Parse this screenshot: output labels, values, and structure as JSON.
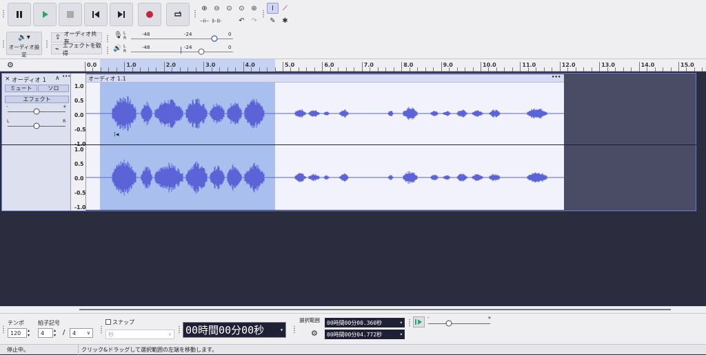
{
  "toolbar": {
    "audio_setup_label": "オーディオ設定",
    "share_audio_label": "オーディオ共有",
    "get_effects_label": "エフェクトを取得",
    "rec_meter": {
      "l": "L",
      "r": "R",
      "marks": [
        "-48",
        "-24",
        "0"
      ]
    },
    "play_meter": {
      "l": "L",
      "r": "R",
      "marks": [
        "-48",
        "-24",
        "0"
      ]
    }
  },
  "ruler": {
    "labels": [
      "0.0",
      "1.0",
      "2.0",
      "3.0",
      "4.0",
      "5.0",
      "6.0",
      "7.0",
      "8.0",
      "9.0",
      "10.0",
      "11.0",
      "12.0",
      "13.0",
      "14.0",
      "15.0"
    ]
  },
  "track": {
    "name": "オーディオ 1",
    "mute": "ミュート",
    "solo": "ソロ",
    "effects": "エフェクト",
    "gain_minus": "-",
    "gain_plus": "+",
    "pan_l": "L",
    "pan_r": "R",
    "clip_name": "オーディオ 1.1",
    "clip_menu": "•••",
    "track_menu": "•••",
    "scale": [
      "1.0",
      "0.5",
      "0.0",
      "-0.5",
      "-1.0"
    ]
  },
  "bottom": {
    "tempo_label": "テンポ",
    "tempo_value": "120",
    "time_sig_label": "拍子記号",
    "time_sig_num": "4",
    "time_sig_slash": "/",
    "time_sig_den": "4",
    "snap_label": "スナップ",
    "snap_unit": "秒",
    "time_display": "00時間00分00秒",
    "selection_label": "選択範囲",
    "sel_start": "00時間00分00.360秒",
    "sel_end": "00時間00分04.772秒",
    "speed_minus": "-",
    "speed_plus": "+"
  },
  "status": {
    "state": "停止中。",
    "hint": "クリック&ドラッグして選択範囲の左端を移動します。"
  },
  "colors": {
    "waveform": "#5b63d6",
    "selection": "#a9c0ee",
    "accent": "#6d7bd6",
    "record": "#c8243a"
  }
}
